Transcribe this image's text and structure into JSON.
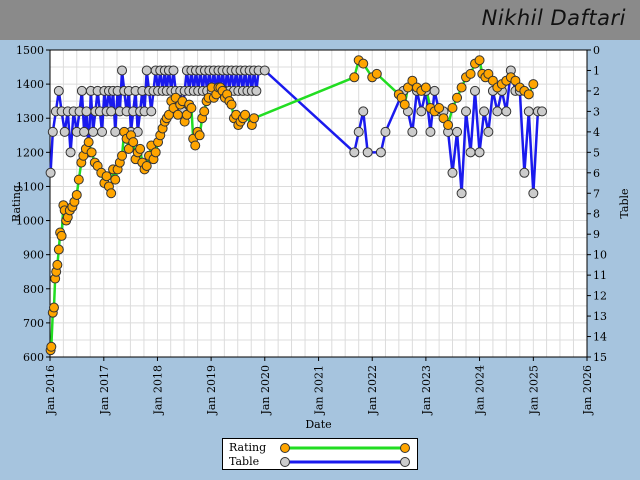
{
  "header": {
    "player_name": "Nikhil Daftari"
  },
  "colors": {
    "rating_line": "#22dd22",
    "rating_marker": "#ffa500",
    "table_line": "#1a1aee",
    "table_marker": "#cccccc",
    "plot_bg": "#ffffff",
    "grid": "#dcdcdc"
  },
  "chart_data": {
    "type": "line",
    "title": "",
    "xlabel": "Date",
    "ylabel_left": "Rating",
    "ylabel_right": "Table",
    "xlim": [
      "2016-01-01",
      "2026-01-01"
    ],
    "ylim_left": [
      600,
      1500
    ],
    "ylim_right": [
      15,
      0
    ],
    "grid": true,
    "legend_position": "bottom-center",
    "x_tick_labels": [
      "Jan 2016",
      "Jan 2017",
      "Jan 2018",
      "Jan 2019",
      "Jan 2020",
      "Jan 2021",
      "Jan 2022",
      "Jan 2023",
      "Jan 2024",
      "Jan 2025",
      "Jan 2026"
    ],
    "y_left_ticks": [
      600,
      700,
      800,
      900,
      1000,
      1100,
      1200,
      1300,
      1400,
      1500
    ],
    "y_right_ticks": [
      0,
      1,
      2,
      3,
      4,
      5,
      6,
      7,
      8,
      9,
      10,
      11,
      12,
      13,
      14,
      15
    ],
    "series": [
      {
        "name": "Rating",
        "axis": "left",
        "points": [
          [
            "2016-01-05",
            620
          ],
          [
            "2016-01-10",
            630
          ],
          [
            "2016-01-20",
            730
          ],
          [
            "2016-01-28",
            745
          ],
          [
            "2016-02-05",
            830
          ],
          [
            "2016-02-12",
            850
          ],
          [
            "2016-02-20",
            870
          ],
          [
            "2016-03-01",
            915
          ],
          [
            "2016-03-10",
            965
          ],
          [
            "2016-03-20",
            955
          ],
          [
            "2016-04-01",
            1045
          ],
          [
            "2016-04-10",
            1030
          ],
          [
            "2016-04-20",
            1000
          ],
          [
            "2016-05-01",
            1010
          ],
          [
            "2016-05-15",
            1030
          ],
          [
            "2016-06-01",
            1040
          ],
          [
            "2016-06-15",
            1055
          ],
          [
            "2016-07-01",
            1075
          ],
          [
            "2016-07-15",
            1120
          ],
          [
            "2016-08-01",
            1170
          ],
          [
            "2016-08-15",
            1190
          ],
          [
            "2016-09-01",
            1210
          ],
          [
            "2016-09-20",
            1230
          ],
          [
            "2016-10-10",
            1200
          ],
          [
            "2016-11-01",
            1170
          ],
          [
            "2016-11-20",
            1160
          ],
          [
            "2016-12-15",
            1140
          ],
          [
            "2017-01-05",
            1110
          ],
          [
            "2017-01-20",
            1130
          ],
          [
            "2017-02-05",
            1100
          ],
          [
            "2017-02-20",
            1080
          ],
          [
            "2017-03-05",
            1150
          ],
          [
            "2017-03-20",
            1120
          ],
          [
            "2017-04-05",
            1150
          ],
          [
            "2017-04-20",
            1170
          ],
          [
            "2017-05-05",
            1190
          ],
          [
            "2017-05-20",
            1260
          ],
          [
            "2017-06-05",
            1240
          ],
          [
            "2017-06-20",
            1210
          ],
          [
            "2017-07-05",
            1250
          ],
          [
            "2017-07-20",
            1230
          ],
          [
            "2017-08-05",
            1180
          ],
          [
            "2017-08-20",
            1200
          ],
          [
            "2017-09-05",
            1210
          ],
          [
            "2017-09-20",
            1170
          ],
          [
            "2017-10-05",
            1150
          ],
          [
            "2017-10-20",
            1160
          ],
          [
            "2017-11-05",
            1190
          ],
          [
            "2017-11-20",
            1220
          ],
          [
            "2017-12-05",
            1180
          ],
          [
            "2017-12-20",
            1200
          ],
          [
            "2018-01-05",
            1230
          ],
          [
            "2018-01-20",
            1250
          ],
          [
            "2018-02-05",
            1270
          ],
          [
            "2018-02-20",
            1290
          ],
          [
            "2018-03-05",
            1300
          ],
          [
            "2018-03-20",
            1310
          ],
          [
            "2018-04-05",
            1350
          ],
          [
            "2018-04-20",
            1330
          ],
          [
            "2018-05-05",
            1360
          ],
          [
            "2018-05-20",
            1310
          ],
          [
            "2018-06-05",
            1340
          ],
          [
            "2018-06-20",
            1350
          ],
          [
            "2018-07-05",
            1290
          ],
          [
            "2018-07-20",
            1310
          ],
          [
            "2018-08-05",
            1340
          ],
          [
            "2018-08-20",
            1330
          ],
          [
            "2018-09-01",
            1240
          ],
          [
            "2018-09-15",
            1220
          ],
          [
            "2018-10-01",
            1260
          ],
          [
            "2018-10-15",
            1250
          ],
          [
            "2018-11-01",
            1300
          ],
          [
            "2018-11-15",
            1320
          ],
          [
            "2018-12-01",
            1350
          ],
          [
            "2018-12-15",
            1360
          ],
          [
            "2019-01-05",
            1390
          ],
          [
            "2019-01-20",
            1360
          ],
          [
            "2019-02-05",
            1370
          ],
          [
            "2019-02-20",
            1390
          ],
          [
            "2019-03-05",
            1390
          ],
          [
            "2019-03-20",
            1380
          ],
          [
            "2019-04-05",
            1360
          ],
          [
            "2019-04-20",
            1370
          ],
          [
            "2019-05-05",
            1350
          ],
          [
            "2019-05-20",
            1340
          ],
          [
            "2019-06-05",
            1300
          ],
          [
            "2019-06-20",
            1310
          ],
          [
            "2019-07-05",
            1280
          ],
          [
            "2019-07-20",
            1290
          ],
          [
            "2019-08-05",
            1300
          ],
          [
            "2019-08-20",
            1310
          ],
          [
            "2019-10-05",
            1280
          ],
          [
            "2019-10-20",
            1300
          ],
          [
            "2021-09-01",
            1420
          ],
          [
            "2021-10-01",
            1470
          ],
          [
            "2021-11-01",
            1460
          ],
          [
            "2022-01-01",
            1420
          ],
          [
            "2022-02-01",
            1430
          ],
          [
            "2022-07-01",
            1370
          ],
          [
            "2022-07-20",
            1360
          ],
          [
            "2022-08-10",
            1340
          ],
          [
            "2022-09-01",
            1390
          ],
          [
            "2022-10-01",
            1410
          ],
          [
            "2022-11-01",
            1390
          ],
          [
            "2022-12-01",
            1380
          ],
          [
            "2023-01-01",
            1390
          ],
          [
            "2023-02-01",
            1330
          ],
          [
            "2023-03-01",
            1320
          ],
          [
            "2023-04-01",
            1330
          ],
          [
            "2023-05-01",
            1300
          ],
          [
            "2023-06-01",
            1280
          ],
          [
            "2023-07-01",
            1330
          ],
          [
            "2023-08-01",
            1360
          ],
          [
            "2023-09-01",
            1390
          ],
          [
            "2023-10-01",
            1420
          ],
          [
            "2023-11-01",
            1430
          ],
          [
            "2023-12-01",
            1460
          ],
          [
            "2024-01-01",
            1470
          ],
          [
            "2024-01-20",
            1430
          ],
          [
            "2024-02-10",
            1420
          ],
          [
            "2024-03-01",
            1430
          ],
          [
            "2024-04-01",
            1410
          ],
          [
            "2024-05-01",
            1390
          ],
          [
            "2024-06-01",
            1400
          ],
          [
            "2024-07-01",
            1410
          ],
          [
            "2024-08-01",
            1420
          ],
          [
            "2024-09-01",
            1410
          ],
          [
            "2024-10-01",
            1390
          ],
          [
            "2024-11-01",
            1380
          ],
          [
            "2024-12-01",
            1370
          ],
          [
            "2025-01-01",
            1400
          ]
        ]
      },
      {
        "name": "Table",
        "axis": "right",
        "points": [
          [
            "2016-01-05",
            6
          ],
          [
            "2016-01-20",
            4
          ],
          [
            "2016-02-10",
            3
          ],
          [
            "2016-03-01",
            2
          ],
          [
            "2016-03-20",
            3
          ],
          [
            "2016-04-10",
            4
          ],
          [
            "2016-05-01",
            3
          ],
          [
            "2016-05-20",
            5
          ],
          [
            "2016-06-10",
            3
          ],
          [
            "2016-07-01",
            4
          ],
          [
            "2016-07-20",
            3
          ],
          [
            "2016-08-05",
            2
          ],
          [
            "2016-08-20",
            4
          ],
          [
            "2016-09-05",
            3
          ],
          [
            "2016-09-20",
            5
          ],
          [
            "2016-10-05",
            2
          ],
          [
            "2016-10-20",
            4
          ],
          [
            "2016-11-05",
            3
          ],
          [
            "2016-11-20",
            2
          ],
          [
            "2016-12-05",
            3
          ],
          [
            "2016-12-20",
            4
          ],
          [
            "2017-01-05",
            2
          ],
          [
            "2017-01-20",
            3
          ],
          [
            "2017-02-05",
            2
          ],
          [
            "2017-02-20",
            3
          ],
          [
            "2017-03-05",
            2
          ],
          [
            "2017-03-20",
            4
          ],
          [
            "2017-04-05",
            2
          ],
          [
            "2017-04-20",
            3
          ],
          [
            "2017-05-05",
            1
          ],
          [
            "2017-05-20",
            2
          ],
          [
            "2017-06-05",
            3
          ],
          [
            "2017-06-20",
            2
          ],
          [
            "2017-07-05",
            4
          ],
          [
            "2017-07-20",
            3
          ],
          [
            "2017-08-05",
            2
          ],
          [
            "2017-08-20",
            4
          ],
          [
            "2017-09-05",
            3
          ],
          [
            "2017-09-20",
            2
          ],
          [
            "2017-10-05",
            3
          ],
          [
            "2017-10-20",
            1
          ],
          [
            "2017-11-05",
            2
          ],
          [
            "2017-11-20",
            3
          ],
          [
            "2017-12-05",
            2
          ],
          [
            "2017-12-20",
            1
          ],
          [
            "2018-01-05",
            2
          ],
          [
            "2018-01-20",
            1
          ],
          [
            "2018-02-05",
            2
          ],
          [
            "2018-02-20",
            1
          ],
          [
            "2018-03-05",
            2
          ],
          [
            "2018-03-20",
            1
          ],
          [
            "2018-04-05",
            2
          ],
          [
            "2018-04-20",
            1
          ],
          [
            "2018-05-05",
            2
          ],
          [
            "2018-05-20",
            3
          ],
          [
            "2018-06-05",
            2
          ],
          [
            "2018-06-20",
            3
          ],
          [
            "2018-07-05",
            2
          ],
          [
            "2018-07-20",
            1
          ],
          [
            "2018-08-05",
            2
          ],
          [
            "2018-08-20",
            1
          ],
          [
            "2018-09-05",
            2
          ],
          [
            "2018-09-20",
            1
          ],
          [
            "2018-10-05",
            2
          ],
          [
            "2018-10-20",
            1
          ],
          [
            "2018-11-05",
            2
          ],
          [
            "2018-11-20",
            1
          ],
          [
            "2018-12-05",
            2
          ],
          [
            "2018-12-20",
            1
          ],
          [
            "2019-01-05",
            2
          ],
          [
            "2019-01-20",
            1
          ],
          [
            "2019-02-05",
            2
          ],
          [
            "2019-02-20",
            1
          ],
          [
            "2019-03-05",
            2
          ],
          [
            "2019-03-20",
            1
          ],
          [
            "2019-04-05",
            2
          ],
          [
            "2019-04-20",
            1
          ],
          [
            "2019-05-05",
            2
          ],
          [
            "2019-05-20",
            1
          ],
          [
            "2019-06-05",
            2
          ],
          [
            "2019-06-20",
            1
          ],
          [
            "2019-07-05",
            2
          ],
          [
            "2019-07-20",
            1
          ],
          [
            "2019-08-05",
            2
          ],
          [
            "2019-08-20",
            1
          ],
          [
            "2019-09-05",
            2
          ],
          [
            "2019-09-20",
            1
          ],
          [
            "2019-10-05",
            2
          ],
          [
            "2019-10-20",
            1
          ],
          [
            "2019-11-05",
            2
          ],
          [
            "2019-11-20",
            1
          ],
          [
            "2020-01-01",
            1
          ],
          [
            "2021-09-01",
            5
          ],
          [
            "2021-10-01",
            4
          ],
          [
            "2021-11-01",
            3
          ],
          [
            "2021-12-01",
            5
          ],
          [
            "2022-03-01",
            5
          ],
          [
            "2022-04-01",
            4
          ],
          [
            "2022-08-01",
            2
          ],
          [
            "2022-09-01",
            3
          ],
          [
            "2022-10-01",
            4
          ],
          [
            "2022-11-01",
            2
          ],
          [
            "2022-12-01",
            3
          ],
          [
            "2023-01-01",
            2
          ],
          [
            "2023-02-01",
            4
          ],
          [
            "2023-03-01",
            2
          ],
          [
            "2023-04-01",
            3
          ],
          [
            "2023-05-01",
            3
          ],
          [
            "2023-06-01",
            4
          ],
          [
            "2023-07-01",
            6
          ],
          [
            "2023-08-01",
            4
          ],
          [
            "2023-09-01",
            7
          ],
          [
            "2023-10-01",
            3
          ],
          [
            "2023-11-01",
            5
          ],
          [
            "2023-12-01",
            2
          ],
          [
            "2024-01-01",
            5
          ],
          [
            "2024-02-01",
            3
          ],
          [
            "2024-03-01",
            4
          ],
          [
            "2024-04-01",
            2
          ],
          [
            "2024-05-01",
            3
          ],
          [
            "2024-06-01",
            2
          ],
          [
            "2024-07-01",
            3
          ],
          [
            "2024-08-01",
            1
          ],
          [
            "2024-09-01",
            2
          ],
          [
            "2024-10-01",
            2
          ],
          [
            "2024-11-01",
            6
          ],
          [
            "2024-12-01",
            3
          ],
          [
            "2025-01-01",
            7
          ],
          [
            "2025-02-01",
            3
          ],
          [
            "2025-03-01",
            3
          ]
        ]
      }
    ]
  }
}
